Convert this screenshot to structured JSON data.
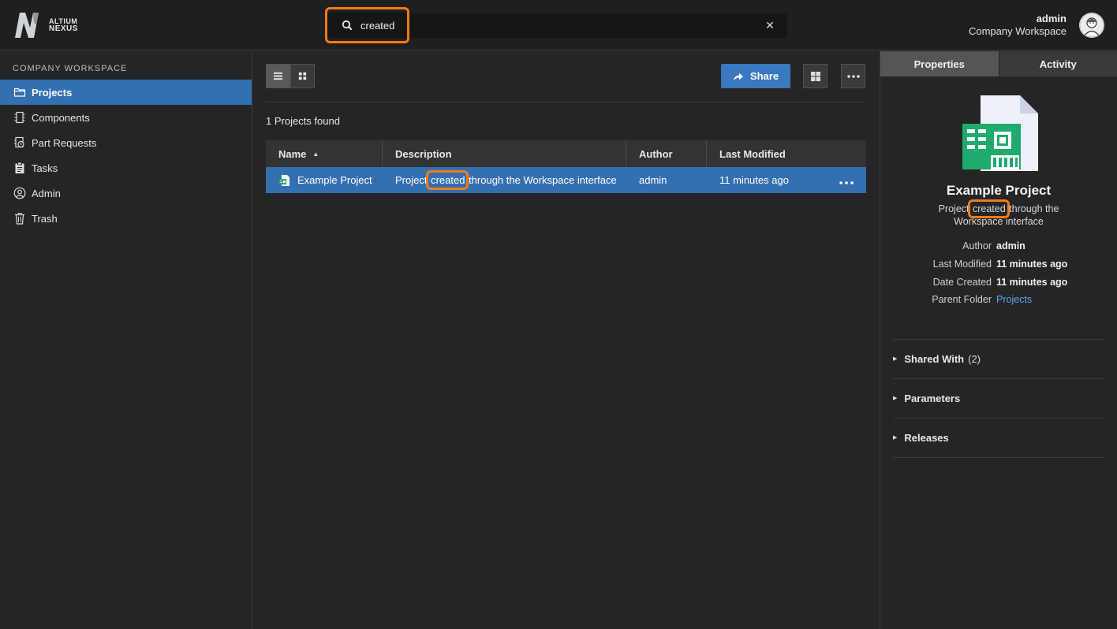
{
  "brand": {
    "line1": "ALTIUM",
    "line2": "NEXUS"
  },
  "search": {
    "value": "created",
    "placeholder": ""
  },
  "user": {
    "name": "admin",
    "workspace": "Company Workspace"
  },
  "sidebar": {
    "heading": "COMPANY WORKSPACE",
    "items": [
      {
        "label": "Projects",
        "icon": "folder-icon",
        "active": true
      },
      {
        "label": "Components",
        "icon": "component-icon"
      },
      {
        "label": "Part Requests",
        "icon": "part-request-icon"
      },
      {
        "label": "Tasks",
        "icon": "clipboard-icon"
      },
      {
        "label": "Admin",
        "icon": "user-circle-icon"
      },
      {
        "label": "Trash",
        "icon": "trash-icon"
      }
    ]
  },
  "toolbar": {
    "share_label": "Share"
  },
  "results": {
    "count_text": "1 Projects found"
  },
  "table": {
    "columns": [
      "Name",
      "Description",
      "Author",
      "Last Modified"
    ],
    "rows": [
      {
        "name": "Example Project",
        "desc_before": "Project ",
        "desc_match": "created",
        "desc_after": " through the Workspace interface",
        "author": "admin",
        "modified": "11 minutes ago"
      }
    ]
  },
  "panel": {
    "tabs": [
      "Properties",
      "Activity"
    ],
    "title": "Example Project",
    "desc_before": "Project ",
    "desc_match": "created",
    "desc_after": " through the Workspace interface",
    "props": [
      {
        "label": "Author",
        "value": "admin"
      },
      {
        "label": "Last Modified",
        "value": "11 minutes ago"
      },
      {
        "label": "Date Created",
        "value": "11 minutes ago"
      },
      {
        "label": "Parent Folder",
        "value": "Projects"
      }
    ],
    "sections": [
      {
        "label": "Shared With",
        "count": "(2)"
      },
      {
        "label": "Parameters"
      },
      {
        "label": "Releases"
      }
    ]
  },
  "colors": {
    "accent": "#3470b0",
    "highlight": "#f07a1a",
    "link": "#5aa7ee",
    "pcb_green": "#1faa6e"
  }
}
